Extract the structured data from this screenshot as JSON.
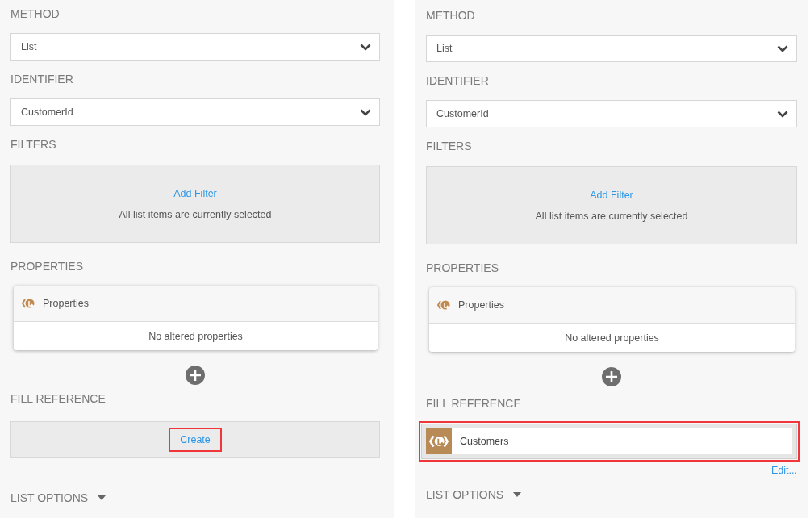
{
  "panels": [
    {
      "method": {
        "label": "METHOD",
        "value": "List"
      },
      "identifier": {
        "label": "IDENTIFIER",
        "value": "CustomerId"
      },
      "filters": {
        "label": "FILTERS",
        "link": "Add Filter",
        "note": "All list items are currently selected"
      },
      "properties": {
        "label": "PROPERTIES",
        "title": "Properties",
        "empty": "No altered properties"
      },
      "fill_reference": {
        "label": "FILL REFERENCE",
        "kind": "create",
        "text": "Create",
        "highlighted": true
      },
      "list_options": {
        "label": "LIST OPTIONS",
        "expanded": false
      }
    },
    {
      "method": {
        "label": "METHOD",
        "value": "List"
      },
      "identifier": {
        "label": "IDENTIFIER",
        "value": "CustomerId"
      },
      "filters": {
        "label": "FILTERS",
        "link": "Add Filter",
        "note": "All list items are currently selected"
      },
      "properties": {
        "label": "PROPERTIES",
        "title": "Properties",
        "empty": "No altered properties"
      },
      "fill_reference": {
        "label": "FILL REFERENCE",
        "kind": "reference",
        "text": "Customers",
        "edit": "Edit...",
        "highlighted": true
      },
      "list_options": {
        "label": "LIST OPTIONS",
        "expanded": false
      }
    }
  ]
}
